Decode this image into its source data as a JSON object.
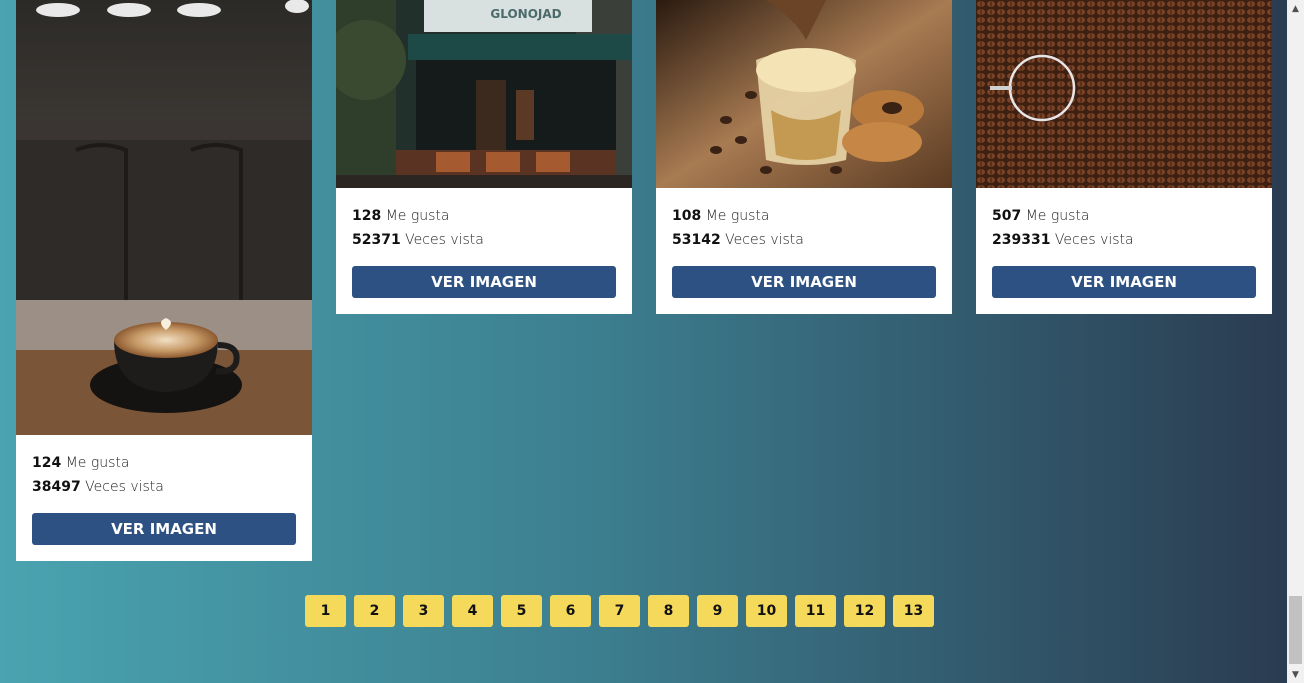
{
  "cards": [
    {
      "likes": "124",
      "likes_label": "Me gusta",
      "views": "38497",
      "views_label": "Veces vista",
      "button": "VER IMAGEN"
    },
    {
      "likes": "128",
      "likes_label": "Me gusta",
      "views": "52371",
      "views_label": "Veces vista",
      "button": "VER IMAGEN"
    },
    {
      "likes": "108",
      "likes_label": "Me gusta",
      "views": "53142",
      "views_label": "Veces vista",
      "button": "VER IMAGEN"
    },
    {
      "likes": "507",
      "likes_label": "Me gusta",
      "views": "239331",
      "views_label": "Veces vista",
      "button": "VER IMAGEN"
    }
  ],
  "pagination": [
    "1",
    "2",
    "3",
    "4",
    "5",
    "6",
    "7",
    "8",
    "9",
    "10",
    "11",
    "12",
    "13"
  ],
  "storefront_sign": "GLONOJAD",
  "colors": {
    "button": "#2e5183",
    "pager": "#f5d95a"
  }
}
